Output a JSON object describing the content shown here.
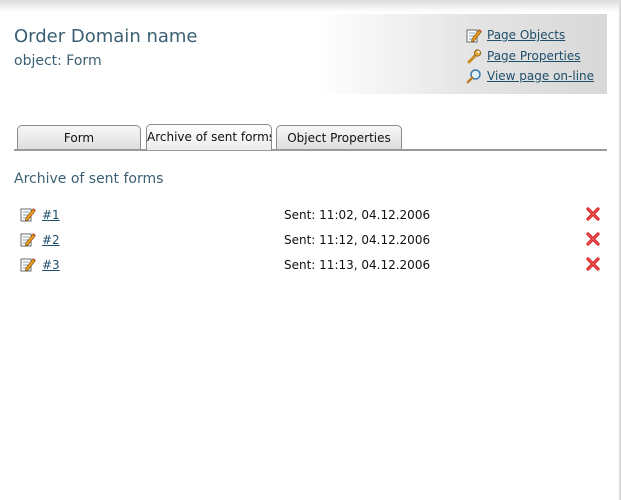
{
  "header": {
    "title": "Order Domain name",
    "subtitle": "object: Form",
    "links": [
      {
        "label": "Page Objects",
        "icon": "pencil-edit-icon"
      },
      {
        "label": "Page Properties",
        "icon": "wrench-icon"
      },
      {
        "label": "View page on-line",
        "icon": "magnifier-icon"
      }
    ]
  },
  "tabs": [
    {
      "label": "Form",
      "active": false
    },
    {
      "label": "Archive of sent forms",
      "active": true
    },
    {
      "label": "Object Properties",
      "active": false
    }
  ],
  "section_title": "Archive of sent forms",
  "rows": [
    {
      "number": "#1",
      "sent": "Sent: 11:02, 04.12.2006"
    },
    {
      "number": "#2",
      "sent": "Sent: 11:12, 04.12.2006"
    },
    {
      "number": "#3",
      "sent": "Sent: 11:13, 04.12.2006"
    }
  ],
  "colors": {
    "title": "#3b5f73",
    "link": "#1f4e6a",
    "delete": "#d81e1e"
  }
}
